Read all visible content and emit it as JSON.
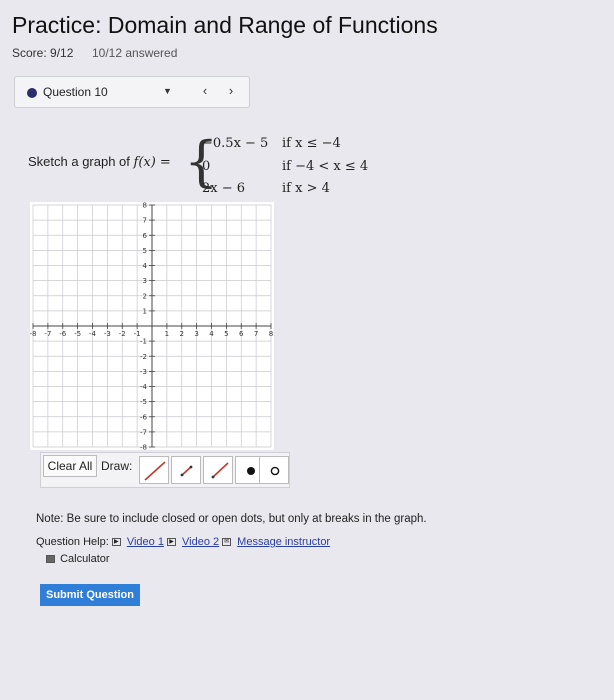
{
  "header": {
    "title": "Practice: Domain and Range of Functions",
    "score": "Score: 9/12",
    "answered": "10/12 answered"
  },
  "question_nav": {
    "selected": "Question 10",
    "prev_icon": "chevron-left-icon",
    "next_icon": "chevron-right-icon"
  },
  "problem": {
    "prompt_prefix": "Sketch a graph of ",
    "function_name": "f(x) =",
    "pieces": [
      {
        "expr": "−0.5x − 5",
        "cond": "if  x ≤ −4"
      },
      {
        "expr": "0",
        "cond": "if  −4 < x ≤ 4"
      },
      {
        "expr": "2x − 6",
        "cond": "if  x > 4"
      }
    ]
  },
  "graph": {
    "x_ticks": [
      "-8",
      "-7",
      "-6",
      "-5",
      "-4",
      "-3",
      "-2",
      "-1",
      "1",
      "2",
      "3",
      "4",
      "5",
      "6",
      "7",
      "8"
    ],
    "y_ticks": [
      "8",
      "7",
      "6",
      "5",
      "4",
      "3",
      "2",
      "1",
      "-1",
      "-2",
      "-3",
      "-4",
      "-5",
      "-6",
      "-7",
      "-8"
    ],
    "xlim": [
      -8,
      8
    ],
    "ylim": [
      -8,
      8
    ],
    "grid": true
  },
  "toolbar": {
    "clear_label": "Clear All",
    "draw_label": "Draw:",
    "tools": [
      "line-tool-icon",
      "segment-tool-icon",
      "ray-tool-icon",
      "closed-dot-icon",
      "open-dot-icon"
    ]
  },
  "note": "Note: Be sure to include closed or open dots, but only at breaks in the graph.",
  "help": {
    "label": "Question Help:",
    "video1": "Video 1",
    "video2": "Video 2",
    "message": "Message instructor",
    "calculator": "Calculator"
  },
  "submit_label": "Submit Question",
  "colors": {
    "accent": "#2f7ed8",
    "question_dot": "#2a2f6b",
    "link": "#2b3f9e",
    "tool_red": "#c0392b"
  }
}
